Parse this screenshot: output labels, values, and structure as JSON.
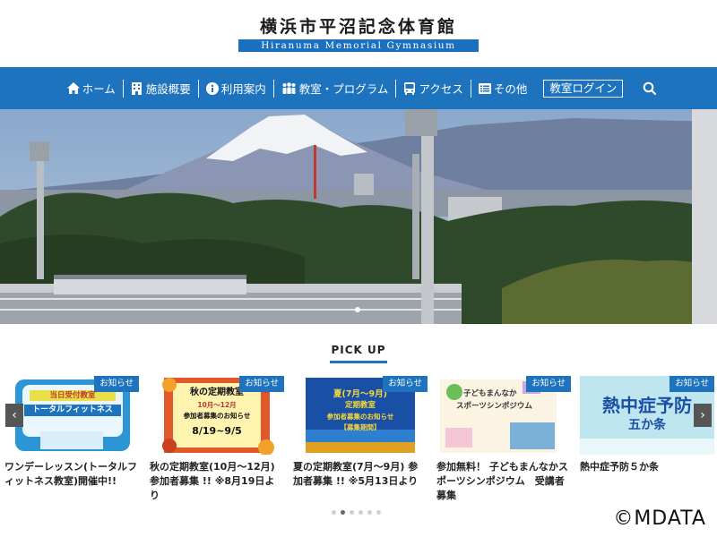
{
  "header": {
    "title_jp": "横浜市平沼記念体育館",
    "title_en": "Hiranuma Memorial Gymnasium"
  },
  "nav": {
    "items": [
      {
        "label": "ホーム",
        "icon": "home-icon"
      },
      {
        "label": "施設概要",
        "icon": "building-icon"
      },
      {
        "label": "利用案内",
        "icon": "info-icon"
      },
      {
        "label": "教室・プログラム",
        "icon": "people-icon"
      },
      {
        "label": "アクセス",
        "icon": "bus-icon"
      },
      {
        "label": "その他",
        "icon": "list-icon"
      }
    ],
    "login_label": "教室ログイン",
    "search_icon": "search-icon"
  },
  "pickup": {
    "title": "PICK UP",
    "badge": "お知らせ",
    "cards": [
      {
        "title": "ワンデーレッスン(トータルフィットネス教室)開催中!!",
        "img_line1": "当日受付教室",
        "img_line2": "トータルフィットネス"
      },
      {
        "title": "秋の定期教室(10月～12月) 参加者募集 !! ※8月19日より",
        "img_line1": "秋の定期教室",
        "img_line2": "10月～12月",
        "img_line3": "参加者募集のお知らせ",
        "img_line4": "8/19~9/5"
      },
      {
        "title": "夏の定期教室(7月～9月) 参加者募集 !! ※5月13日より",
        "img_line1": "夏(7月～9月)",
        "img_line2": "定期教室",
        "img_line3": "参加者募集のお知らせ",
        "img_line4": "【募集期間】"
      },
      {
        "title": "参加無料！ 子どもまんなかスポーツシンポジウム　受講者募集",
        "img_line1": "子どもまんなか",
        "img_line2": "スポーツシンポジウム"
      },
      {
        "title": "熱中症予防５か条",
        "img_line1": "熱中症予防",
        "img_line2": "五か条"
      }
    ]
  },
  "watermark": "©MDATA",
  "colors": {
    "primary": "#1e73be",
    "badge": "#1e73be"
  }
}
